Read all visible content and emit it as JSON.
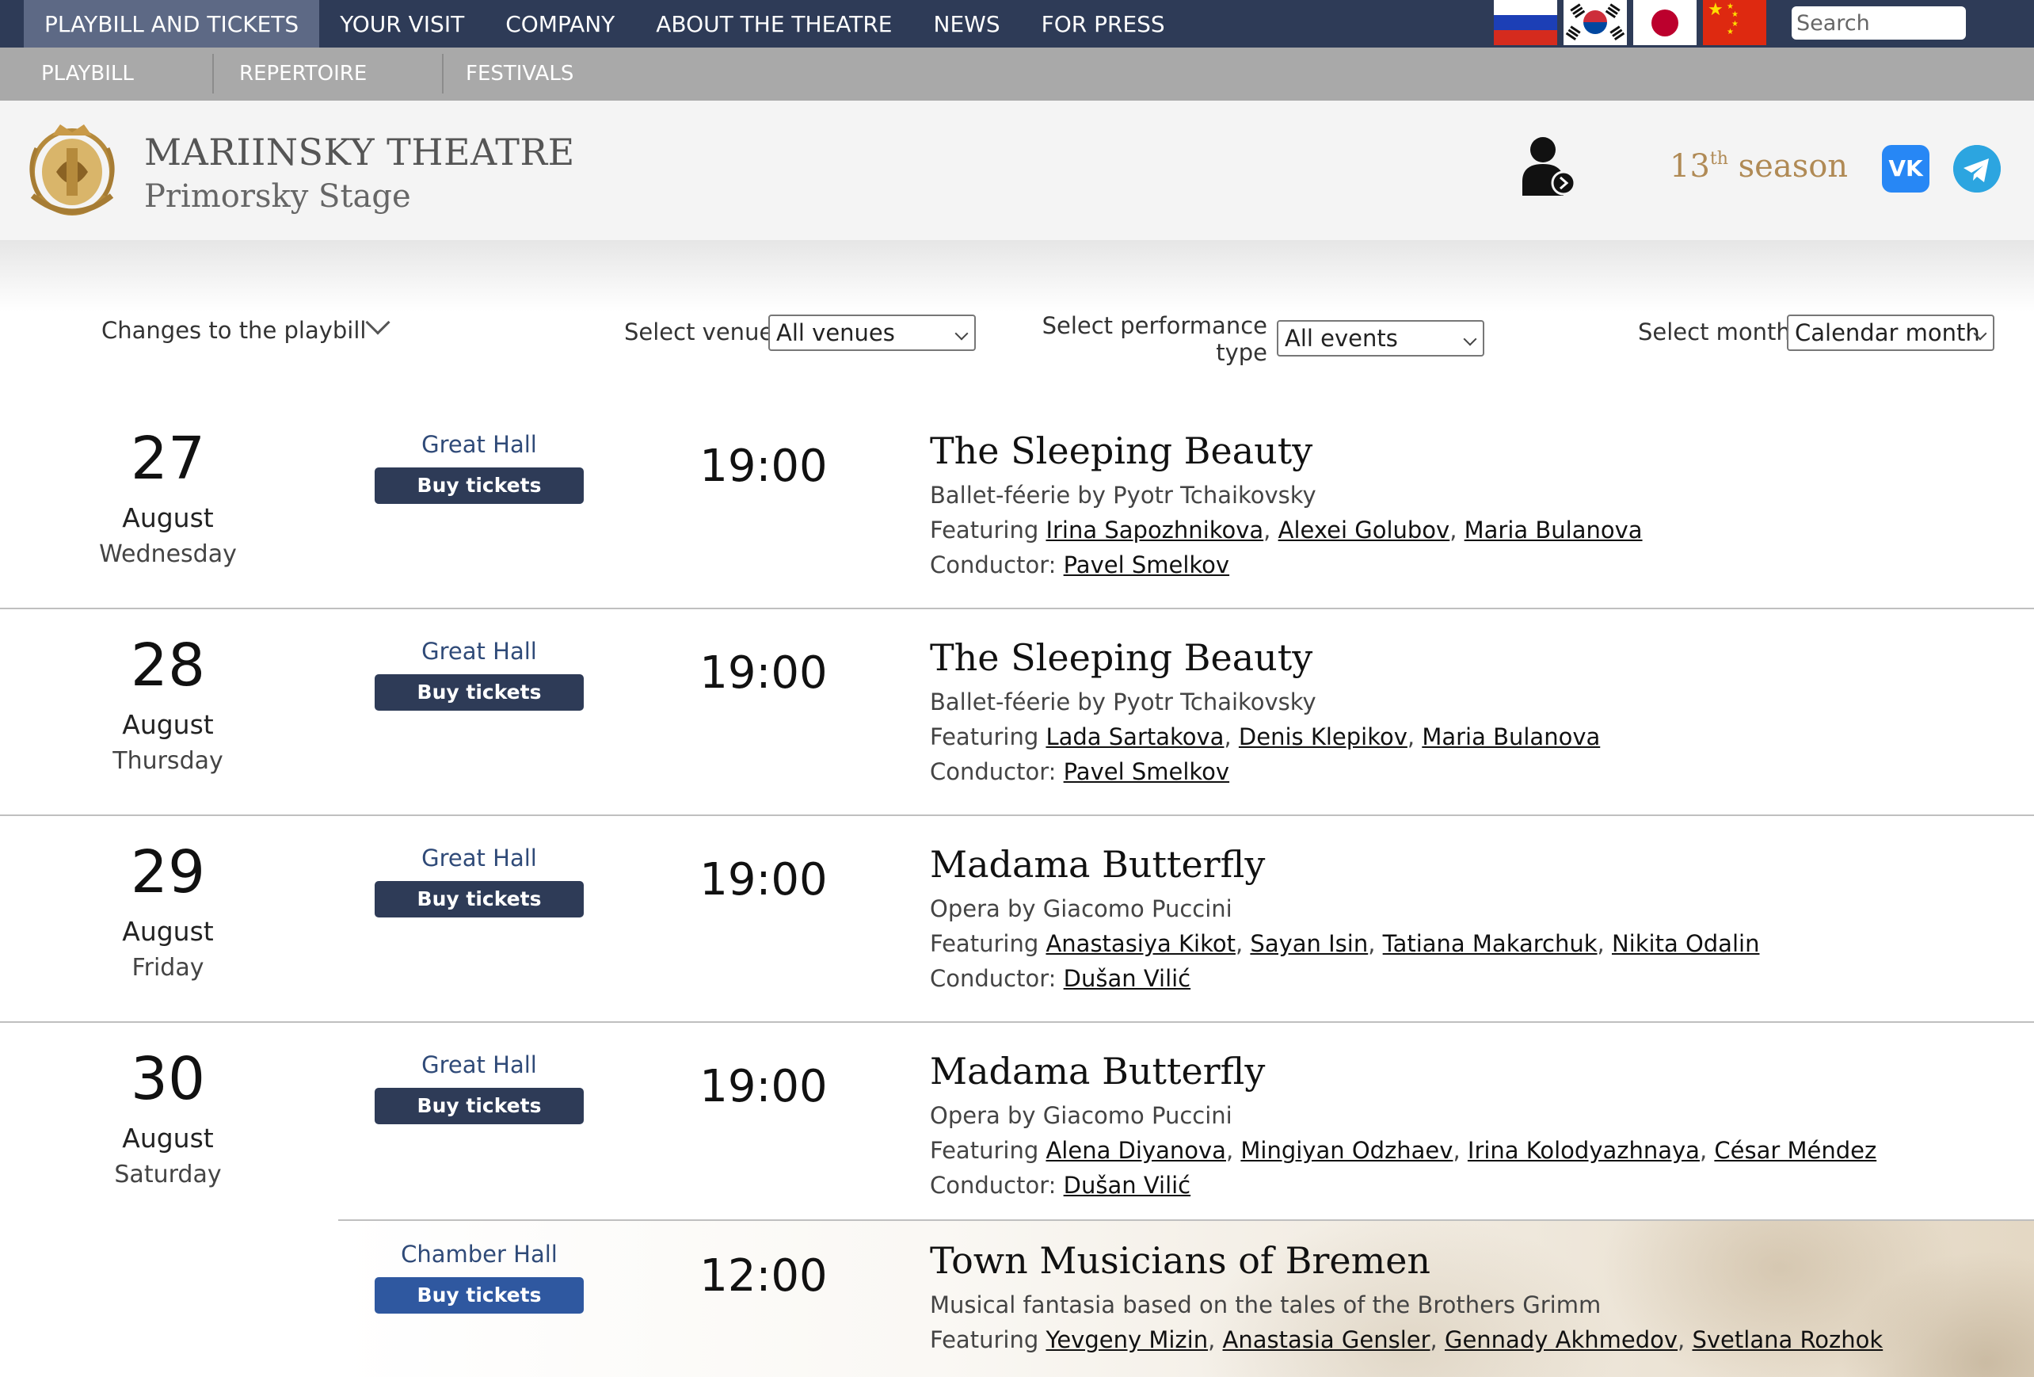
{
  "top_nav": {
    "items": [
      "PLAYBILL AND TICKETS",
      "YOUR VISIT",
      "COMPANY",
      "ABOUT THE THEATRE",
      "NEWS",
      "FOR PRESS"
    ],
    "active_index": 0,
    "languages": [
      "russian-flag-icon",
      "korean-flag-icon",
      "japanese-flag-icon",
      "chinese-flag-icon"
    ],
    "search_placeholder": "Search"
  },
  "sub_nav": {
    "items": [
      "PLAYBILL",
      "REPERTOIRE",
      "FESTIVALS"
    ]
  },
  "header": {
    "title": "MARIINSKY THEATRE",
    "subtitle": "Primorsky Stage",
    "season_number": "13",
    "season_suffix": "th",
    "season_word": "season",
    "vk_label": "VK"
  },
  "filters": {
    "changes_label": "Changes to the playbill",
    "venue_label": "Select venue",
    "venue_value": "All venues",
    "type_label_line1": "Select performance",
    "type_label_line2": "type",
    "type_value": "All events",
    "month_label": "Select month",
    "month_value": "Calendar month"
  },
  "buy_label": "Buy tickets",
  "labels": {
    "featuring": "Featuring",
    "conductor": "Conductor:"
  },
  "days": [
    {
      "day": "27",
      "month": "August",
      "weekday": "Wednesday"
    },
    {
      "day": "28",
      "month": "August",
      "weekday": "Thursday"
    },
    {
      "day": "29",
      "month": "August",
      "weekday": "Friday"
    },
    {
      "day": "30",
      "month": "August",
      "weekday": "Saturday"
    }
  ],
  "events": [
    {
      "hall": "Great Hall",
      "time": "19:00",
      "title": "The Sleeping Beauty",
      "desc": "Ballet-féerie by Pyotr Tchaikovsky",
      "cast": [
        "Irina Sapozhnikova",
        "Alexei Golubov",
        "Maria Bulanova"
      ],
      "conductor": "Pavel Smelkov"
    },
    {
      "hall": "Great Hall",
      "time": "19:00",
      "title": "The Sleeping Beauty",
      "desc": "Ballet-féerie by Pyotr Tchaikovsky",
      "cast": [
        "Lada Sartakova",
        "Denis Klepikov",
        "Maria Bulanova"
      ],
      "conductor": "Pavel Smelkov"
    },
    {
      "hall": "Great Hall",
      "time": "19:00",
      "title": "Madama Butterfly",
      "desc": "Opera by Giacomo Puccini",
      "cast": [
        "Anastasiya Kikot",
        "Sayan Isin",
        "Tatiana Makarchuk",
        "Nikita Odalin"
      ],
      "conductor": "Dušan Vilić"
    },
    {
      "hall": "Great Hall",
      "time": "19:00",
      "title": "Madama Butterfly",
      "desc": "Opera by Giacomo Puccini",
      "cast": [
        "Alena Diyanova",
        "Mingiyan Odzhaev",
        "Irina Kolodyazhnaya",
        "César Méndez"
      ],
      "conductor": "Dušan Vilić"
    },
    {
      "hall": "Chamber Hall",
      "time": "12:00",
      "title": "Town Musicians of Bremen",
      "desc": "Musical fantasia based on the tales of the Brothers Grimm",
      "cast": [
        "Yevgeny Mizin",
        "Anastasia Gensler",
        "Gennady Akhmedov",
        "Svetlana Rozhok"
      ],
      "conductor": ""
    }
  ],
  "colors": {
    "nav_dark": "#2e3b57",
    "nav_active": "#5d6985",
    "subnav": "#a9a9a9",
    "season_gold": "#b08a55",
    "hall_blue": "#2f4a78"
  }
}
